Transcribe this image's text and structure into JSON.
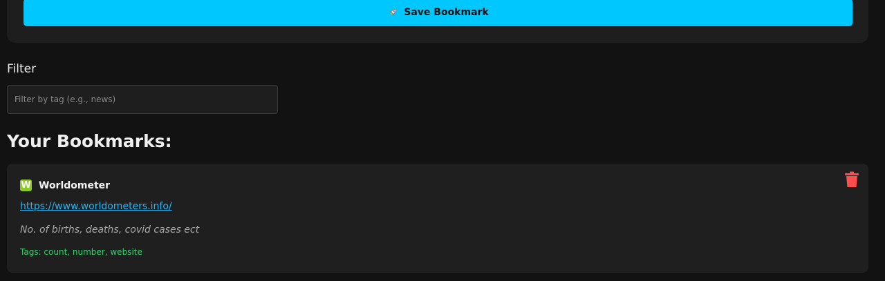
{
  "form": {
    "save_label": "Save Bookmark",
    "save_icon": "rocket-icon"
  },
  "filter": {
    "label": "Filter",
    "placeholder": "Filter by tag (e.g., news)",
    "value": ""
  },
  "bookmarks_heading": "Your Bookmarks:",
  "bookmarks": [
    {
      "favicon_letter": "W",
      "title": "Worldometer",
      "url": "https://www.worldometers.info/",
      "description": "No. of births, deaths, covid cases ect",
      "tags_text": "Tags: count, number, website",
      "delete_icon": "trash-icon"
    }
  ],
  "colors": {
    "background": "#121212",
    "card": "#1f1f1f",
    "accent_button": "#00c8ff",
    "link": "#29b6f6",
    "tags": "#35d36a",
    "delete": "#ff4d4d",
    "favicon": "#8ac926"
  }
}
